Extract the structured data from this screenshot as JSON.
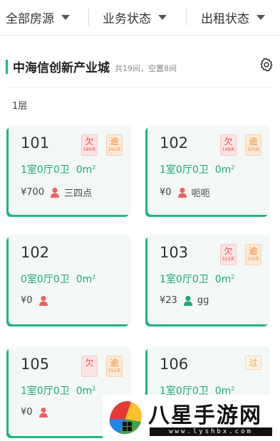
{
  "filters": [
    {
      "label": "全部房源"
    },
    {
      "label": "业务状态"
    },
    {
      "label": "出租状态"
    }
  ],
  "project": {
    "name": "中海信创新产业城",
    "summary": "共19间，空置8间"
  },
  "floor_label": "1层",
  "area_unit": "m²",
  "cards": [
    {
      "room": "101",
      "layout": "1室0厅0卫",
      "area": "0m",
      "price": "¥700",
      "tenant": "三四点",
      "tenant_color": "#f06060",
      "badges": [
        {
          "ch": "欠",
          "sub": "589天",
          "style": "red"
        },
        {
          "ch": "逾",
          "sub": "291天",
          "style": "orange"
        }
      ]
    },
    {
      "room": "102",
      "layout": "1室0厅0卫",
      "area": "0m",
      "price": "¥0",
      "tenant": "呃呃",
      "tenant_color": "#f06060",
      "badges": [
        {
          "ch": "欠",
          "sub": "148天",
          "style": "red"
        },
        {
          "ch": "逾",
          "sub": "320天",
          "style": "orange"
        }
      ]
    },
    {
      "room": "102",
      "layout": "0室0厅0卫",
      "area": "0m",
      "price": "¥0",
      "tenant": "",
      "tenant_color": "#f06060",
      "badges": []
    },
    {
      "room": "103",
      "layout": "1室0厅0卫",
      "area": "0m",
      "price": "¥23",
      "tenant": "gg",
      "tenant_color": "#1aa77c",
      "badges": [
        {
          "ch": "欠",
          "sub": "513天",
          "style": "red"
        },
        {
          "ch": "逾",
          "sub": "330天",
          "style": "orange"
        }
      ]
    },
    {
      "room": "105",
      "layout": "1室0厅0卫",
      "area": "0m",
      "price": "¥0",
      "tenant": "",
      "tenant_color": "#f06060",
      "badges": [
        {
          "ch": "欠",
          "sub": "",
          "style": "red"
        },
        {
          "ch": "逾",
          "sub": "352天",
          "style": "orange"
        }
      ]
    },
    {
      "room": "106",
      "layout": "1室0厅0卫",
      "area": "0m",
      "price": "",
      "tenant": "",
      "tenant_color": "#f06060",
      "badges": [
        {
          "ch": "过",
          "sub": "",
          "style": "orange-plain"
        }
      ]
    }
  ],
  "watermark": {
    "title": "八星手游网",
    "url": "www.lyshbx.com"
  }
}
